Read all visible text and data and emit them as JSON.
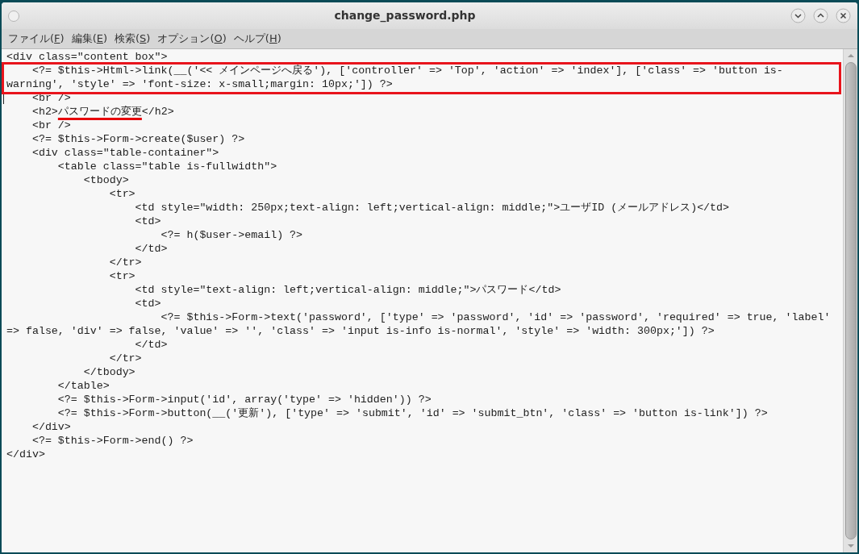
{
  "window": {
    "title": "change_password.php"
  },
  "menu": [
    {
      "label": "ファイル(",
      "key": "F",
      "end": ")"
    },
    {
      "label": "編集(",
      "key": "E",
      "end": ")"
    },
    {
      "label": "検索(",
      "key": "S",
      "end": ")"
    },
    {
      "label": "オプション(",
      "key": "O",
      "end": ")"
    },
    {
      "label": "ヘルプ(",
      "key": "H",
      "end": ")"
    }
  ],
  "lines": [
    {
      "text": "<div class=\"content box\">",
      "highlighted": false
    },
    {
      "text": "    <?= $this->Html->link(__('<< メインページへ戻る'), ['controller' => 'Top', 'action' => 'index'], ['class' => 'button is-",
      "highlighted": true
    },
    {
      "text": "warning', 'style' => 'font-size: x-small;margin: 10px;']) ?>",
      "highlighted": true
    },
    {
      "text": "    <br />",
      "highlighted": false
    },
    {
      "segments": [
        {
          "text": "    <h2>",
          "underlined": false
        },
        {
          "text": "パスワードの変更",
          "underlined": true
        },
        {
          "text": "</h2>",
          "underlined": false
        }
      ],
      "highlighted": false
    },
    {
      "text": "    <br />",
      "highlighted": false
    },
    {
      "text": "    <?= $this->Form->create($user) ?>",
      "highlighted": false
    },
    {
      "text": "    <div class=\"table-container\">",
      "highlighted": false
    },
    {
      "text": "        <table class=\"table is-fullwidth\">",
      "highlighted": false
    },
    {
      "text": "            <tbody>",
      "highlighted": false
    },
    {
      "text": "                <tr>",
      "highlighted": false
    },
    {
      "text": "                    <td style=\"width: 250px;text-align: left;vertical-align: middle;\">ユーザID (メールアドレス)</td>",
      "highlighted": false
    },
    {
      "text": "                    <td>",
      "highlighted": false
    },
    {
      "text": "                        <?= h($user->email) ?>",
      "highlighted": false
    },
    {
      "text": "                    </td>",
      "highlighted": false
    },
    {
      "text": "                </tr>",
      "highlighted": false
    },
    {
      "text": "                <tr>",
      "highlighted": false
    },
    {
      "text": "                    <td style=\"text-align: left;vertical-align: middle;\">パスワード</td>",
      "highlighted": false
    },
    {
      "text": "                    <td>",
      "highlighted": false
    },
    {
      "text": "                        <?= $this->Form->text('password', ['type' => 'password', 'id' => 'password', 'required' => true, 'label'",
      "highlighted": false
    },
    {
      "text": "=> false, 'div' => false, 'value' => '', 'class' => 'input is-info is-normal', 'style' => 'width: 300px;']) ?>",
      "highlighted": false
    },
    {
      "text": "                    </td>",
      "highlighted": false
    },
    {
      "text": "                </tr>",
      "highlighted": false
    },
    {
      "text": "            </tbody>",
      "highlighted": false
    },
    {
      "text": "        </table>",
      "highlighted": false
    },
    {
      "text": "        <?= $this->Form->input('id', array('type' => 'hidden')) ?>",
      "highlighted": false
    },
    {
      "text": "        <?= $this->Form->button(__('更新'), ['type' => 'submit', 'id' => 'submit_btn', 'class' => 'button is-link']) ?>",
      "highlighted": false
    },
    {
      "text": "    </div>",
      "highlighted": false
    },
    {
      "text": "    <?= $this->Form->end() ?>",
      "highlighted": false
    },
    {
      "text": "</div>",
      "highlighted": false
    }
  ]
}
